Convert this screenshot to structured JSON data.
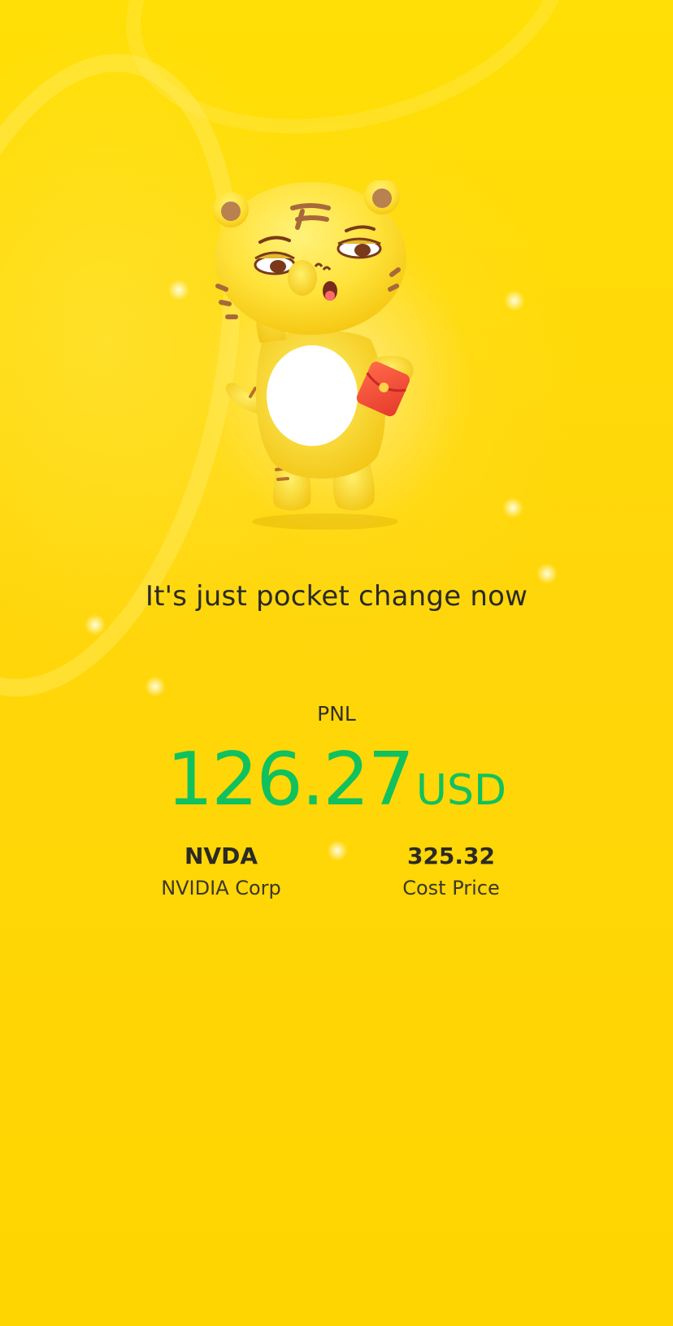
{
  "message": "It's just pocket change now",
  "pnl": {
    "label": "PNL",
    "value": "126.27",
    "currency": "USD"
  },
  "stock": {
    "ticker": "NVDA",
    "name": "NVIDIA Corp"
  },
  "cost": {
    "value": "325.32",
    "label": "Cost Price"
  },
  "colors": {
    "background": "#ffd800",
    "pnl_positive": "#10c15e",
    "text": "#2b2a24"
  },
  "mascot": {
    "icon": "tiger-mascot-icon",
    "prop": "red-envelope-icon"
  }
}
